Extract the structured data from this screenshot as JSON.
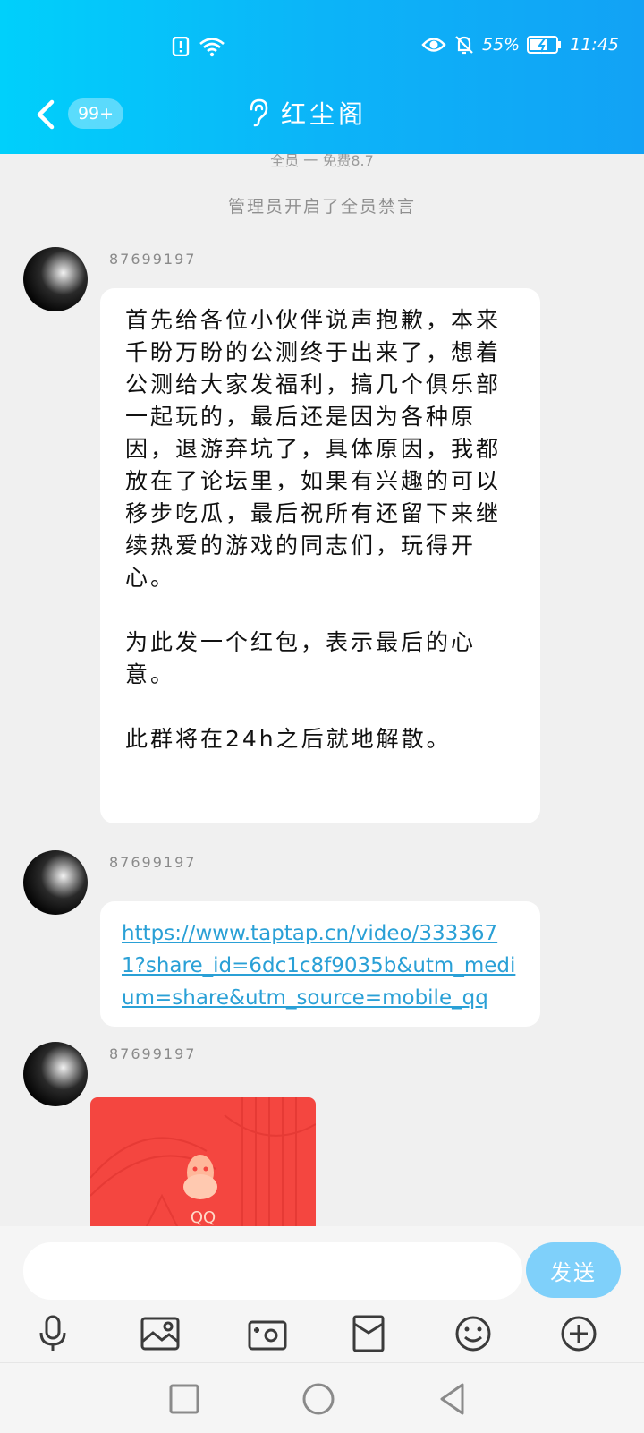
{
  "status": {
    "battery": "55%",
    "time": "11:45"
  },
  "header": {
    "unread_badge": "99+",
    "title": "红尘阁"
  },
  "chat": {
    "cut_text": "全员 一 免费8.7",
    "notice": "管理员开启了全员禁言",
    "messages": [
      {
        "sender": "87699197",
        "paragraphs": [
          "首先给各位小伙伴说声抱歉，本来千盼万盼的公测终于出来了，想着公测给大家发福利，搞几个俱乐部一起玩的，最后还是因为各种原因，退游弃坑了，具体原因，我都放在了论坛里，如果有兴趣的可以移步吃瓜，最后祝所有还留下来继续热爱的游戏的同志们，玩得开心。",
          "为此发一个红包，表示最后的心意。",
          "此群将在24h之后就地解散。"
        ]
      },
      {
        "sender": "87699197",
        "link": "https://www.taptap.cn/video/3333671?share_id=6dc1c8f9035b&utm_medium=share&utm_source=mobile_qq"
      },
      {
        "sender": "87699197",
        "red_packet_label": "QQ"
      }
    ]
  },
  "input_bar": {
    "placeholder": "",
    "send_label": "发送"
  },
  "colors": {
    "header_start": "#00d0fb",
    "header_end": "#12a2f5",
    "link": "#2aa0d6",
    "red_packet": "#f44640",
    "send": "#7fd0fa"
  },
  "icons": [
    "back-arrow-icon",
    "ear-icon",
    "microphone-icon",
    "picture-icon",
    "camera-icon",
    "red-packet-icon",
    "emoji-icon",
    "plus-icon"
  ]
}
